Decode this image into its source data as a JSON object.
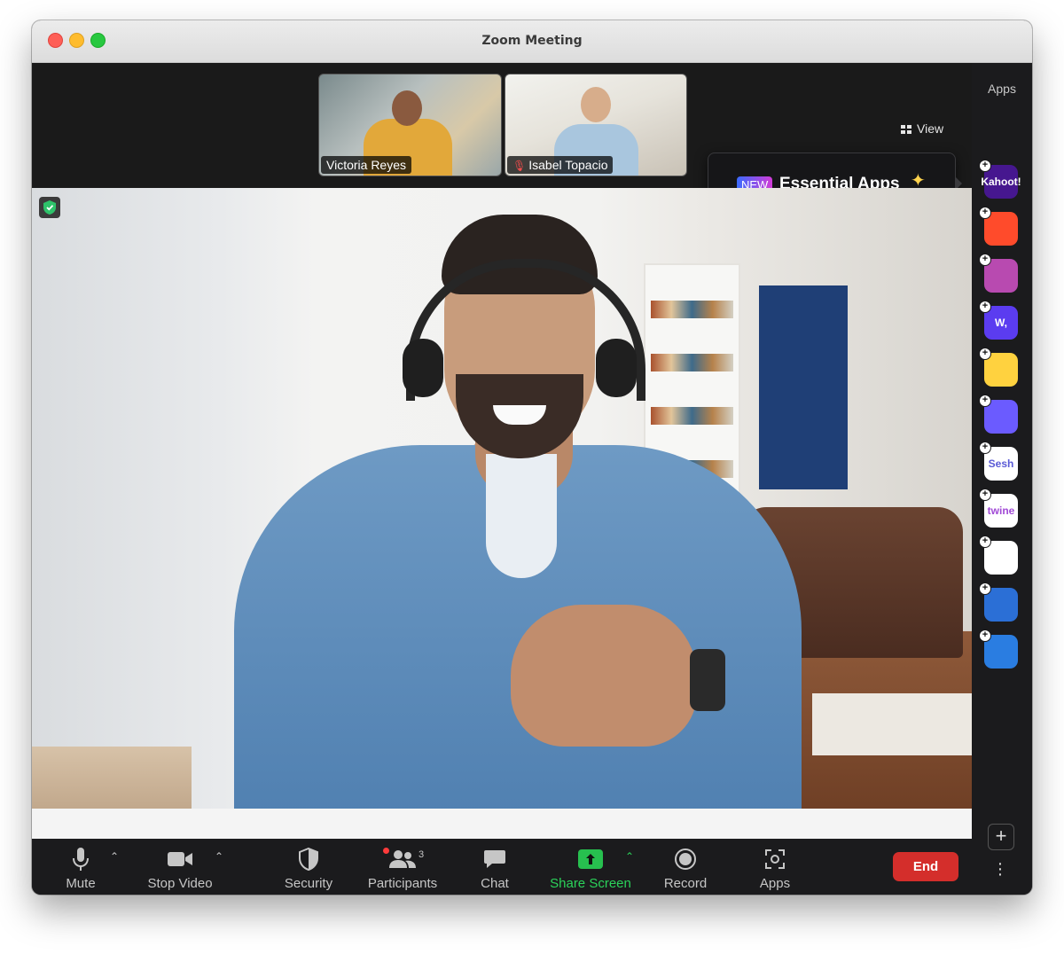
{
  "window": {
    "title": "Zoom Meeting"
  },
  "top": {
    "view_label": "View",
    "view_icon": "grid-icon"
  },
  "thumbnails": [
    {
      "name": "Victoria Reyes",
      "muted": false
    },
    {
      "name": "Isabel Topacio",
      "muted": true
    }
  ],
  "tooltip": {
    "badge": "NEW",
    "text": "Essential Apps",
    "icon": "sparkle-icon"
  },
  "sidebar": {
    "title": "Apps",
    "apps": [
      {
        "label": "Kahoot!",
        "bg": "#46178f",
        "fg": "#ffffff"
      },
      {
        "label": "",
        "bg": "#ff4b2b",
        "fg": "#ffffff"
      },
      {
        "label": "",
        "bg": "#b84ab0",
        "fg": "#ffffff"
      },
      {
        "label": "W,",
        "bg": "#5b3cf0",
        "fg": "#ffffff"
      },
      {
        "label": "",
        "bg": "#ffd23f",
        "fg": "#222222"
      },
      {
        "label": "",
        "bg": "#6b5bff",
        "fg": "#ffffff"
      },
      {
        "label": "Sesh",
        "bg": "#ffffff",
        "fg": "#5b5bd6"
      },
      {
        "label": "twine",
        "bg": "#ffffff",
        "fg": "#a14ad6"
      },
      {
        "label": "",
        "bg": "#ffffff",
        "fg": "#333333"
      },
      {
        "label": "",
        "bg": "#2b6fd6",
        "fg": "#ffffff"
      },
      {
        "label": "",
        "bg": "#2a7de1",
        "fg": "#ffffff"
      }
    ]
  },
  "toolbar": {
    "mute_label": "Mute",
    "stop_video_label": "Stop Video",
    "security_label": "Security",
    "participants_label": "Participants",
    "participants_count": "3",
    "chat_label": "Chat",
    "share_screen_label": "Share Screen",
    "record_label": "Record",
    "apps_label": "Apps",
    "end_label": "End"
  },
  "colors": {
    "share_green": "#27c04f",
    "end_red": "#d42e2b",
    "toolbar_bg": "#1b1b1d"
  }
}
